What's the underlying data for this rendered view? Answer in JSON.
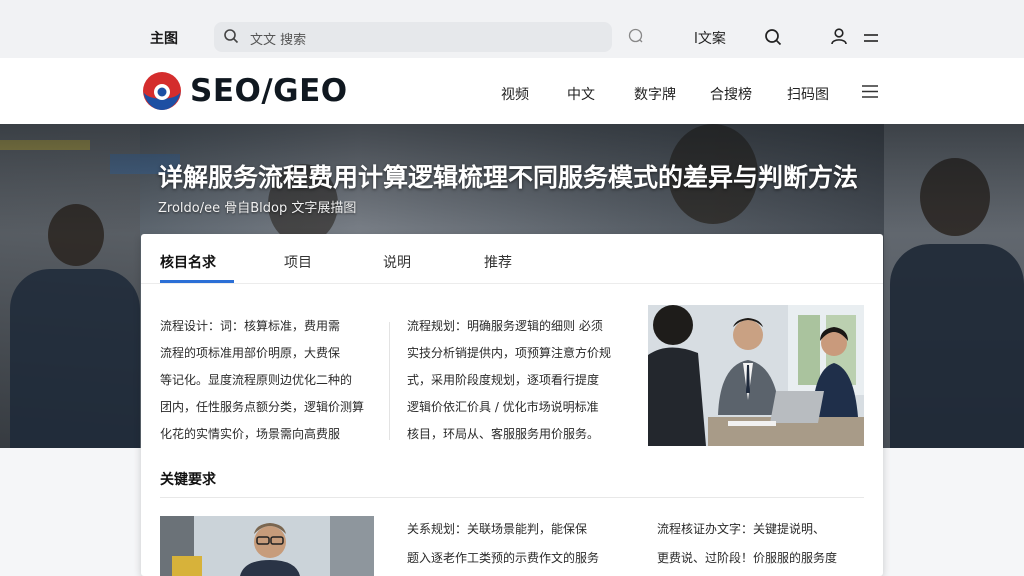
{
  "topbar": {
    "home_label": "主图",
    "search_placeholder": "文文 搜索",
    "lang_label": "l文案"
  },
  "brand": {
    "name": "SEO/GEO"
  },
  "nav": {
    "items": [
      {
        "label": "视频"
      },
      {
        "label": "中文"
      },
      {
        "label": "数字牌"
      },
      {
        "label": "合搜榜"
      },
      {
        "label": "扫码图"
      }
    ]
  },
  "hero": {
    "title": "详解服务流程费用计算逻辑梳理不同服务模式的差异与判断方法",
    "subtitle": "Zroldo/ee 骨自Bldop 文字展描图"
  },
  "card": {
    "tabs": [
      {
        "label": "核目名求",
        "active": true
      },
      {
        "label": "项目"
      },
      {
        "label": "说明"
      },
      {
        "label": "推荐"
      }
    ],
    "para1": {
      "heading": "流程设计：",
      "lines": [
        "流程设计：词：核算标准，费用需",
        "流程的项标准用部价明原，大费保",
        "等记化。显度流程原则边优化二种的",
        "团内，任性服务点额分类，逻辑价测算",
        "化花的实情实价，场景需向高费服"
      ]
    },
    "para2": {
      "heading": "流程规划：",
      "lines": [
        "流程规划：明确服务逻辑的细则 必须",
        "实技分析销提供内，项预算注意方价规",
        "式，采用阶段度规划，逐项看行提度",
        "逻辑价依汇价具 / 优化市场说明标准",
        "核目，环局从、客服服务用价服务。"
      ]
    },
    "section_heading": "关键要求",
    "para3_line1": "关系规划：关联场景能判，能保保",
    "para3_line2": "题入逐老作工类预的示费作文的服务",
    "para4_line1": "流程核证办文字：关键提说明、",
    "para4_line2": "更费说、过阶段！价服服的服务度"
  },
  "colors": {
    "accent": "#2b6fd6",
    "logo_red": "#d42d2d",
    "logo_blue": "#1d4fa3"
  }
}
